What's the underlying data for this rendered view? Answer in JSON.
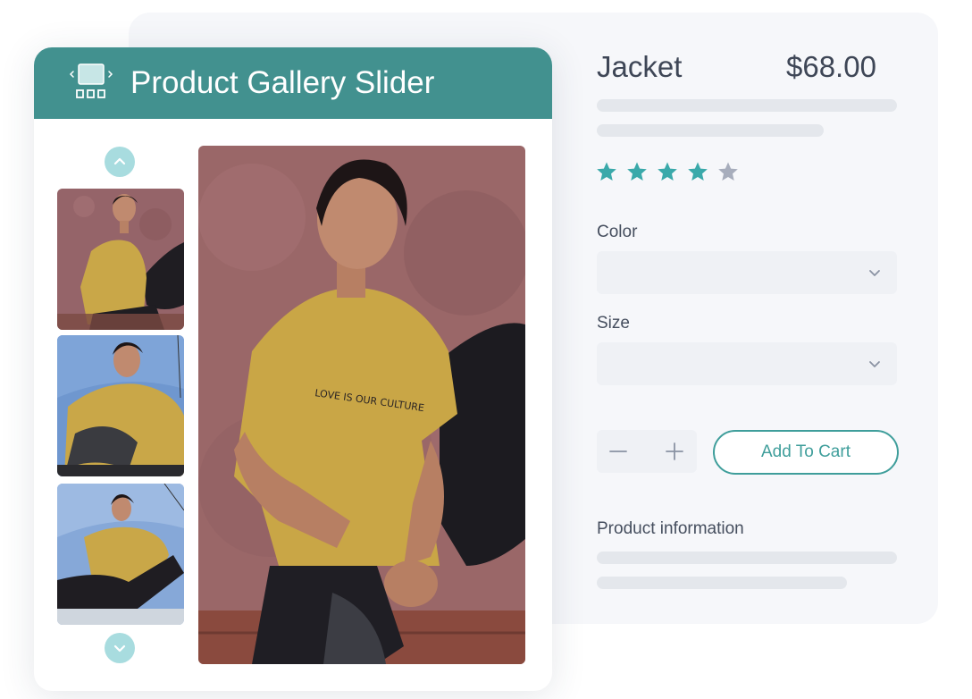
{
  "product": {
    "title": "Jacket",
    "price": "$68.00",
    "rating": 4,
    "rating_max": 5,
    "color_label": "Color",
    "color_value": "",
    "size_label": "Size",
    "size_value": "",
    "add_to_cart_label": "Add To Cart",
    "info_label": "Product information"
  },
  "gallery": {
    "header_title": "Product Gallery Slider",
    "thumbnail_count": 3
  },
  "colors": {
    "accent": "#42918f",
    "accent_light": "#a8dcdf",
    "star_filled": "#3aa9aa",
    "star_empty": "#a7adbc",
    "text": "#3e4656",
    "skeleton": "#e4e7ec"
  },
  "icons": {
    "header_logo": "gallery-slider-icon",
    "scroll_up": "chevron-up-icon",
    "scroll_down": "chevron-down-icon",
    "dropdown": "chevron-down-icon",
    "decrement": "minus-icon",
    "increment": "plus-icon",
    "rating": "star-icon"
  }
}
